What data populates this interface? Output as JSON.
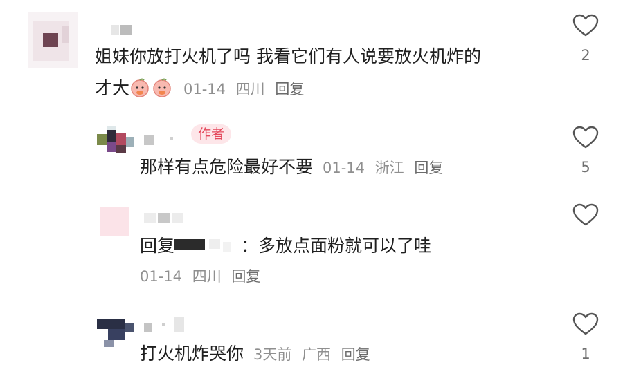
{
  "comments": [
    {
      "text_line1": "姐妹你放打火机了吗 我看它们有人说要放火机炸的",
      "text_line2": "才大",
      "emojis": [
        "peach-face-emoji",
        "peach-face-emoji"
      ],
      "date": "01-14",
      "location": "四川",
      "reply_label": "回复",
      "like_count": "2"
    },
    {
      "author_badge": "作者",
      "text": "那样有点危险最好不要",
      "date": "01-14",
      "location": "浙江",
      "reply_label": "回复",
      "like_count": "5"
    },
    {
      "reply_prefix": "回复",
      "text": "：多放点面粉就可以了哇",
      "date": "01-14",
      "location": "四川",
      "reply_label": "回复",
      "like_count": ""
    },
    {
      "text": "打火机炸哭你",
      "date": "3天前",
      "location": "广西",
      "reply_label": "回复",
      "like_count": "1"
    }
  ],
  "colors": {
    "author_badge_bg": "#fde6e9",
    "author_badge_text": "#e4495c",
    "meta_text": "#8f8f8f",
    "like_icon": "#555555"
  }
}
